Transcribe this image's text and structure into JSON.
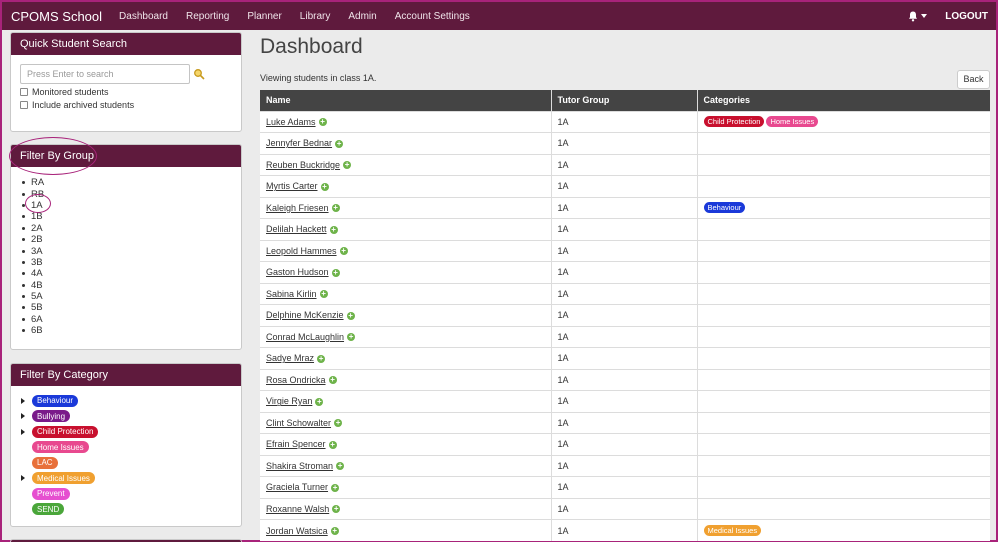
{
  "navbar": {
    "brand": "CPOMS School",
    "items": [
      "Dashboard",
      "Reporting",
      "Planner",
      "Library",
      "Admin",
      "Account Settings"
    ],
    "logout": "LOGOUT"
  },
  "quick_search": {
    "title": "Quick Student Search",
    "placeholder": "Press Enter to search",
    "monitored_label": "Monitored students",
    "archived_label": "Include archived students"
  },
  "filter_group": {
    "title": "Filter By Group",
    "groups": [
      "RA",
      "RB",
      "1A",
      "1B",
      "2A",
      "2B",
      "3A",
      "3B",
      "4A",
      "4B",
      "5A",
      "5B",
      "6A",
      "6B"
    ]
  },
  "filter_category": {
    "title": "Filter By Category",
    "categories": [
      {
        "label": "Behaviour",
        "color": "#1a39d9",
        "expandable": true
      },
      {
        "label": "Bullying",
        "color": "#7a1a8a",
        "expandable": true
      },
      {
        "label": "Child Protection",
        "color": "#c8102e",
        "expandable": true
      },
      {
        "label": "Home Issues",
        "color": "#e8498f",
        "expandable": false
      },
      {
        "label": "LAC",
        "color": "#e8703a",
        "expandable": false
      },
      {
        "label": "Medical Issues",
        "color": "#f0a030",
        "expandable": true
      },
      {
        "label": "Prevent",
        "color": "#e64fd0",
        "expandable": false
      },
      {
        "label": "SEND",
        "color": "#4aa63a",
        "expandable": false
      }
    ]
  },
  "main": {
    "title": "Dashboard",
    "subtitle": "Viewing students in class 1A.",
    "back_label": "Back",
    "columns": [
      "Name",
      "Tutor Group",
      "Categories"
    ],
    "students": [
      {
        "name": "Luke Adams",
        "group": "1A",
        "tags": [
          {
            "label": "Child Protection",
            "color": "#c8102e"
          },
          {
            "label": "Home Issues",
            "color": "#e8498f"
          }
        ]
      },
      {
        "name": "Jennyfer Bednar",
        "group": "1A",
        "tags": []
      },
      {
        "name": "Reuben Buckridge",
        "group": "1A",
        "tags": []
      },
      {
        "name": "Myrtis Carter",
        "group": "1A",
        "tags": []
      },
      {
        "name": "Kaleigh Friesen",
        "group": "1A",
        "tags": [
          {
            "label": "Behaviour",
            "color": "#1a39d9"
          }
        ]
      },
      {
        "name": "Delilah Hackett",
        "group": "1A",
        "tags": []
      },
      {
        "name": "Leopold Hammes",
        "group": "1A",
        "tags": []
      },
      {
        "name": "Gaston Hudson",
        "group": "1A",
        "tags": []
      },
      {
        "name": "Sabina Kirlin",
        "group": "1A",
        "tags": []
      },
      {
        "name": "Delphine McKenzie",
        "group": "1A",
        "tags": []
      },
      {
        "name": "Conrad McLaughlin",
        "group": "1A",
        "tags": []
      },
      {
        "name": "Sadye Mraz",
        "group": "1A",
        "tags": []
      },
      {
        "name": "Rosa Ondricka",
        "group": "1A",
        "tags": []
      },
      {
        "name": "Virgie Ryan",
        "group": "1A",
        "tags": []
      },
      {
        "name": "Clint Schowalter",
        "group": "1A",
        "tags": []
      },
      {
        "name": "Efrain Spencer",
        "group": "1A",
        "tags": []
      },
      {
        "name": "Shakira Stroman",
        "group": "1A",
        "tags": []
      },
      {
        "name": "Graciela Turner",
        "group": "1A",
        "tags": []
      },
      {
        "name": "Roxanne Walsh",
        "group": "1A",
        "tags": []
      },
      {
        "name": "Jordan Watsica",
        "group": "1A",
        "tags": [
          {
            "label": "Medical Issues",
            "color": "#f0a030"
          }
        ]
      }
    ]
  }
}
